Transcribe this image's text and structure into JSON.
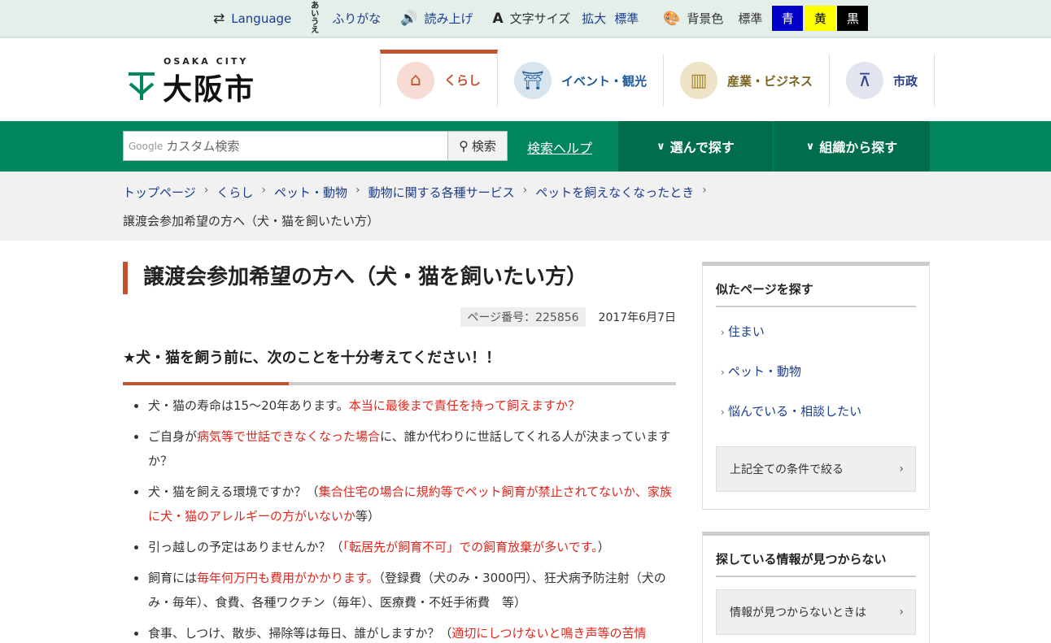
{
  "utility": {
    "language": "Language",
    "furigana": "ふりがな",
    "furigana_icon": "あい うえ",
    "readaloud": "読み上げ",
    "textsize_label": "文字サイズ",
    "textsize_enlarge": "拡大",
    "textsize_standard": "標準",
    "bgcolor_label": "背景色",
    "bg_standard": "標準",
    "bg_blue": "青",
    "bg_yellow": "黄",
    "bg_black": "黒"
  },
  "header": {
    "logo_sub": "OSAKA CITY",
    "logo_text": "大阪市"
  },
  "globalnav": [
    {
      "label": "くらし",
      "color": "#c0532f",
      "icon_bg": "#f6dcd3"
    },
    {
      "label": "イベント・観光",
      "color": "#1f5a9a",
      "icon_bg": "#d6e5ef"
    },
    {
      "label": "産業・ビジネス",
      "color": "#7a6320",
      "icon_bg": "#eee3c6"
    },
    {
      "label": "市政",
      "color": "#2a3f88",
      "icon_bg": "#e2e4f0"
    }
  ],
  "search": {
    "google": "Google",
    "placeholder": "カスタム検索",
    "button": "検索",
    "help": "検索ヘルプ",
    "tab_choose": "選んで探す",
    "tab_org": "組織から探す"
  },
  "breadcrumb": {
    "items": [
      "トップページ",
      "くらし",
      "ペット・動物",
      "動物に関する各種サービス",
      "ペットを飼えなくなったとき"
    ],
    "current": "譲渡会参加希望の方へ（犬・猫を飼いたい方）"
  },
  "main": {
    "title": "譲渡会参加希望の方へ（犬・猫を飼いたい方）",
    "page_no": "ページ番号：225856",
    "date": "2017年6月7日",
    "section_heading": "★犬・猫を飼う前に、次のことを十分考えてください！！",
    "items": [
      {
        "a": "犬・猫の寿命は15～20年あります。",
        "r": "本当に最後まで責任を持って飼えますか？",
        "c": ""
      },
      {
        "a": "ご自身が",
        "r": "病気等で世話できなくなった場合",
        "c": "に、誰か代わりに世話してくれる人が決まっていますか？"
      },
      {
        "a": "犬・猫を飼える環境ですか？（",
        "r": "集合住宅の場合に規約等でペット飼育が禁止されてないか、家族に犬・猫のアレルギーの方がいないか",
        "c": "等）"
      },
      {
        "a": "引っ越しの予定はありませんか？（",
        "r": "「転居先が飼育不可」での飼育放棄が多いです。",
        "c": "）"
      },
      {
        "a": "飼育には",
        "r": "毎年何万円も費用がかかります。",
        "c": "（登録費（犬のみ・3000円）、狂犬病予防注射（犬のみ・毎年）、食費、各種ワクチン（毎年）、医療費・不妊手術費　等）"
      },
      {
        "a": "食事、しつけ、散歩、掃除等は毎日、誰がしますか？（",
        "r": "適切にしつけないと鳴き声等の苦情",
        "c": ""
      }
    ]
  },
  "sidebar": {
    "similar_title": "似たページを探す",
    "similar_links": [
      "住まい",
      "ペット・動物",
      "悩んでいる・相談したい"
    ],
    "narrow_button": "上記全ての条件で絞る",
    "notfound_title": "探している情報が見つからない",
    "notfound_button": "情報が見つからないときは"
  }
}
